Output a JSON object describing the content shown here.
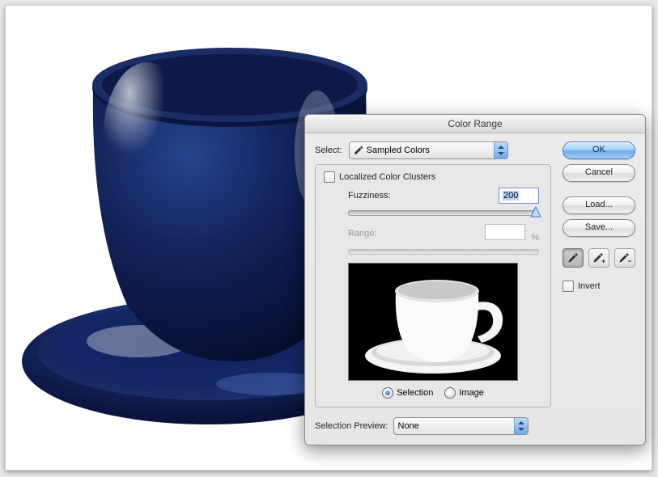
{
  "dialog": {
    "title": "Color Range",
    "select_label": "Select:",
    "select_value": "Sampled Colors",
    "localized_label": "Localized Color Clusters",
    "fuzziness_label": "Fuzziness:",
    "fuzziness_value": "200",
    "range_label": "Range:",
    "range_unit": "%",
    "selection_label": "Selection",
    "image_label": "Image",
    "preview_mode": "selection",
    "selection_preview_label": "Selection Preview:",
    "selection_preview_value": "None",
    "buttons": {
      "ok": "OK",
      "cancel": "Cancel",
      "load": "Load...",
      "save": "Save..."
    },
    "invert_label": "Invert",
    "invert_checked": false
  }
}
